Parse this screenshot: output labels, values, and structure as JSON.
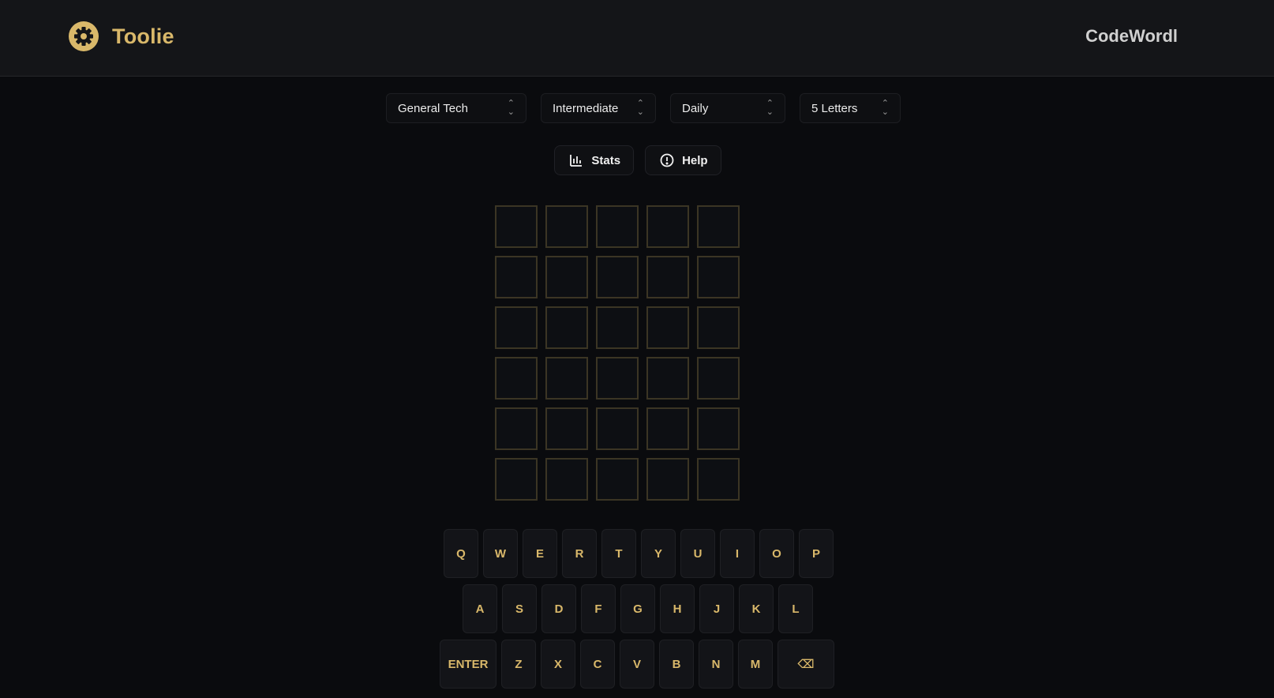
{
  "header": {
    "brand": "Toolie",
    "brand_icon": "gear-icon",
    "app_title": "CodeWordl",
    "accent": "#d9b86a"
  },
  "filters": [
    {
      "label": "General Tech"
    },
    {
      "label": "Intermediate"
    },
    {
      "label": "Daily"
    },
    {
      "label": "5 Letters"
    }
  ],
  "actions": {
    "stats_label": "Stats",
    "stats_icon": "bar-chart-icon",
    "help_label": "Help",
    "help_icon": "info-circle-icon"
  },
  "board": {
    "rows": 6,
    "cols": 5
  },
  "keyboard": {
    "row1": [
      "Q",
      "W",
      "E",
      "R",
      "T",
      "Y",
      "U",
      "I",
      "O",
      "P"
    ],
    "row2": [
      "A",
      "S",
      "D",
      "F",
      "G",
      "H",
      "J",
      "K",
      "L"
    ],
    "row3": [
      "ENTER",
      "Z",
      "X",
      "C",
      "V",
      "B",
      "N",
      "M",
      "⌫"
    ]
  }
}
